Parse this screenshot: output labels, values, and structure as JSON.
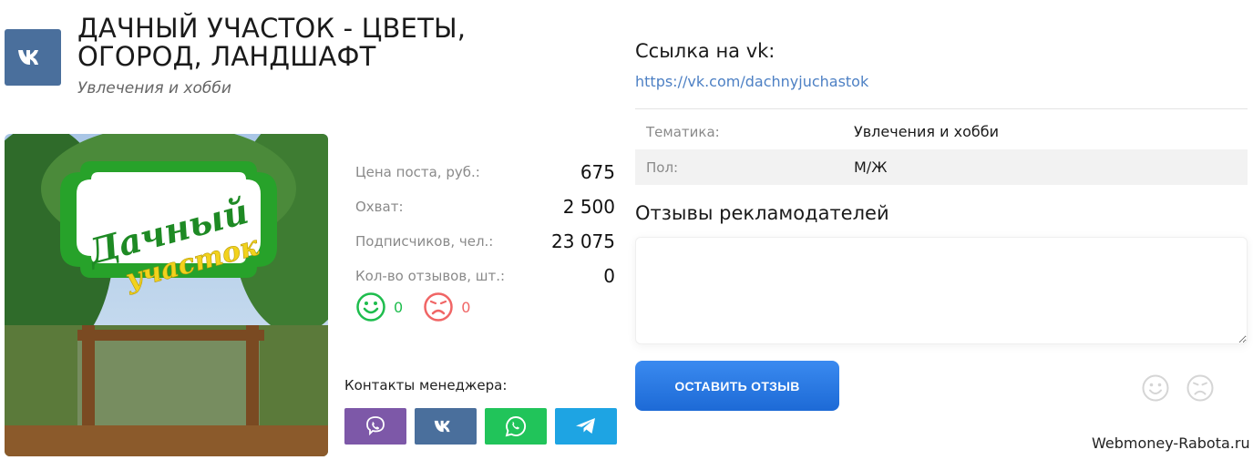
{
  "header": {
    "title": "ДАЧНЫЙ УЧАСТОК - ЦВЕТЫ, ОГОРОД, ЛАНДШАФТ",
    "category": "Увлечения и хобби",
    "logo_icon": "vk-icon"
  },
  "photo": {
    "logo_line1": "Дачный",
    "logo_line2": "участок"
  },
  "stats": [
    {
      "label": "Цена поста, руб.:",
      "value": "675"
    },
    {
      "label": "Охват:",
      "value": "2 500"
    },
    {
      "label": "Подписчиков, чел.:",
      "value": "23 075"
    },
    {
      "label": "Кол-во отзывов, шт.:",
      "value": "0"
    }
  ],
  "reactions": {
    "positive_count": "0",
    "negative_count": "0",
    "positive_color": "#1ebd4d",
    "negative_color": "#f06565"
  },
  "contacts": {
    "title": "Контакты менеджера:",
    "buttons": [
      {
        "icon": "viber-icon",
        "color": "#7d58a8"
      },
      {
        "icon": "vk-icon",
        "color": "#4a6f9c"
      },
      {
        "icon": "whatsapp-icon",
        "color": "#21c45a"
      },
      {
        "icon": "telegram-icon",
        "color": "#1ea4e3"
      }
    ]
  },
  "link": {
    "title": "Ссылка на vk:",
    "url": "https://vk.com/dachnyjuchastok"
  },
  "info": [
    {
      "label": "Тематика:",
      "value": "Увлечения и хобби"
    },
    {
      "label": "Пол:",
      "value": "М/Ж"
    }
  ],
  "reviews": {
    "title": "Отзывы рекламодателей",
    "textarea_value": "",
    "submit_label": "ОСТАВИТЬ ОТЗЫВ"
  },
  "watermark": "Webmoney-Rabota.ru",
  "colors": {
    "accent": "#1d6ad6",
    "link": "#4d80c4"
  }
}
